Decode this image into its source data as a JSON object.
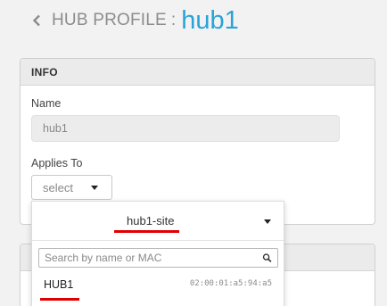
{
  "header": {
    "prefix": "HUB PROFILE",
    "separator": ":",
    "name": "hub1",
    "accent_color": "#29a3d8"
  },
  "info_card": {
    "title": "INFO",
    "name_label": "Name",
    "name_value": "hub1",
    "applies_to_label": "Applies To",
    "applies_to_value": "select"
  },
  "dropdown": {
    "selected_site": "hub1-site",
    "search_placeholder": "Search by name or MAC",
    "items": [
      {
        "name": "HUB1",
        "mac": "02:00:01:a5:94:a5"
      }
    ],
    "highlight_color": "#e00000"
  }
}
